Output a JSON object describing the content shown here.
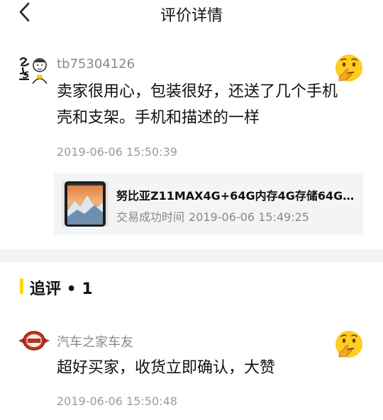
{
  "header": {
    "title": "评价详情",
    "back_icon": "chevron-left-icon"
  },
  "review": {
    "username": "tb75304126",
    "text_line1": "卖家很用心，包装很好，还送了几个手机",
    "text_line2": "壳和支架。手机和描述的一样",
    "time": "2019-06-06 15:50:39",
    "avatar_icon": "calligraphy-avatar",
    "emoji_icon": "thinking-face-emoji"
  },
  "product": {
    "title": "努比亚Z11MAX4G+64G内存4G存储64G6...",
    "trade_label": "交易成功时间",
    "trade_time": "2019-06-06 15:49:25",
    "thumb_icon": "phone-thumbnail"
  },
  "follow_up": {
    "label": "追评 • 1",
    "username": "汽车之家车友",
    "text": "超好买家，收货立即确认，大赞",
    "time": "2019-06-06 15:50:48",
    "avatar_icon": "autohome-badge-avatar",
    "emoji_icon": "thinking-face-emoji"
  },
  "colors": {
    "accent": "#ffd700",
    "muted": "#888888",
    "emoji": "#ffcc22"
  }
}
